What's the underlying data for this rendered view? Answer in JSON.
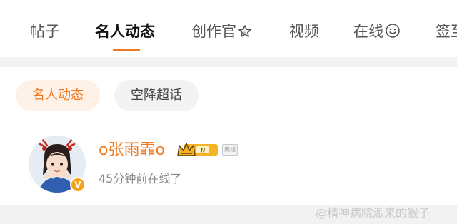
{
  "tabs": [
    {
      "label": "帖子"
    },
    {
      "label": "名人动态"
    },
    {
      "label": "创作官"
    },
    {
      "label": "视频"
    },
    {
      "label": "在线"
    },
    {
      "label": "签至"
    }
  ],
  "filters": {
    "active_label": "名人动态",
    "idle_label": "空降超话"
  },
  "profile": {
    "username": "o张雨霏o",
    "level_badge": "II",
    "status_tag": "离线",
    "last_seen": "45分钟前在线了",
    "verified_icon": "v-badge-icon"
  },
  "watermark": "@精神病院派来的猴子",
  "colors": {
    "accent": "#f07a22",
    "chip_active_bg": "#fef2e8",
    "chip_idle_bg": "#f3f3f3",
    "crown_gold": "#f4b323"
  }
}
